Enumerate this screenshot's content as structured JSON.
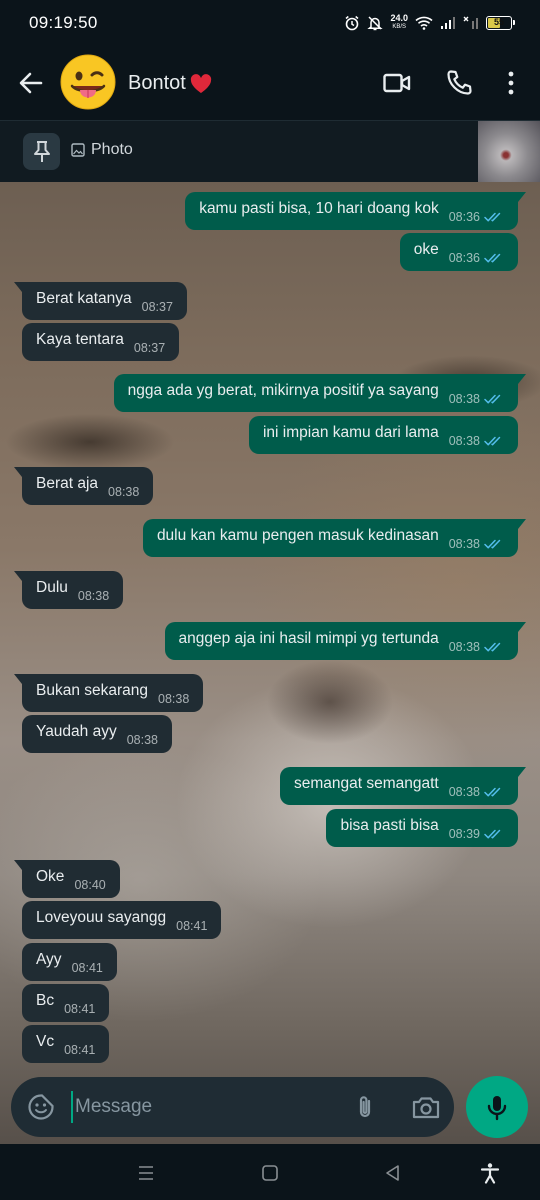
{
  "status_bar": {
    "time": "09:19:50",
    "net_speed_value": "24.0",
    "net_speed_unit": "KB/S",
    "battery_level": "55",
    "battery_percent": 55
  },
  "header": {
    "contact_name": "Bontot",
    "avatar_icon": "grinning-tongue-emoji",
    "name_badge_icon": "red-heart-icon"
  },
  "pinned": {
    "label": "Photo",
    "media_icon": "image-icon"
  },
  "messages": [
    {
      "dir": "out",
      "text": "kamu pasti bisa, 10 hari doang kok",
      "time": "08:36",
      "read": true
    },
    {
      "dir": "out",
      "text": "oke",
      "time": "08:36",
      "read": true
    },
    {
      "dir": "in",
      "text": "Berat katanya",
      "time": "08:37"
    },
    {
      "dir": "in",
      "text": "Kaya tentara",
      "time": "08:37"
    },
    {
      "dir": "out",
      "text": "ngga ada yg berat, mikirnya positif ya sayang",
      "time": "08:38",
      "read": true
    },
    {
      "dir": "out",
      "text": "ini impian kamu dari lama",
      "time": "08:38",
      "read": true
    },
    {
      "dir": "in",
      "text": "Berat aja",
      "time": "08:38"
    },
    {
      "dir": "out",
      "text": "dulu kan kamu pengen masuk kedinasan",
      "time": "08:38",
      "read": true
    },
    {
      "dir": "in",
      "text": "Dulu",
      "time": "08:38"
    },
    {
      "dir": "out",
      "text": "anggep aja ini hasil mimpi yg tertunda",
      "time": "08:38",
      "read": true
    },
    {
      "dir": "in",
      "text": "Bukan sekarang",
      "time": "08:38"
    },
    {
      "dir": "in",
      "text": "Yaudah ayy",
      "time": "08:38"
    },
    {
      "dir": "out",
      "text": "semangat semangatt",
      "time": "08:38",
      "read": true
    },
    {
      "dir": "out",
      "text": "bisa pasti bisa",
      "time": "08:39",
      "read": true
    },
    {
      "dir": "in",
      "text": "Oke",
      "time": "08:40"
    },
    {
      "dir": "in",
      "text": "Loveyouu sayangg",
      "time": "08:41"
    },
    {
      "dir": "in",
      "text": "Ayy",
      "time": "08:41"
    },
    {
      "dir": "in",
      "text": "Bc",
      "time": "08:41"
    },
    {
      "dir": "in",
      "text": "Vc",
      "time": "08:41"
    }
  ],
  "composer": {
    "placeholder": "Message",
    "value": ""
  },
  "colors": {
    "app_bg": "#0b141a",
    "incoming_bubble": "#202c33",
    "outgoing_bubble": "#005c4b",
    "accent_green": "#00a884",
    "read_tick_blue": "#53bdeb"
  }
}
